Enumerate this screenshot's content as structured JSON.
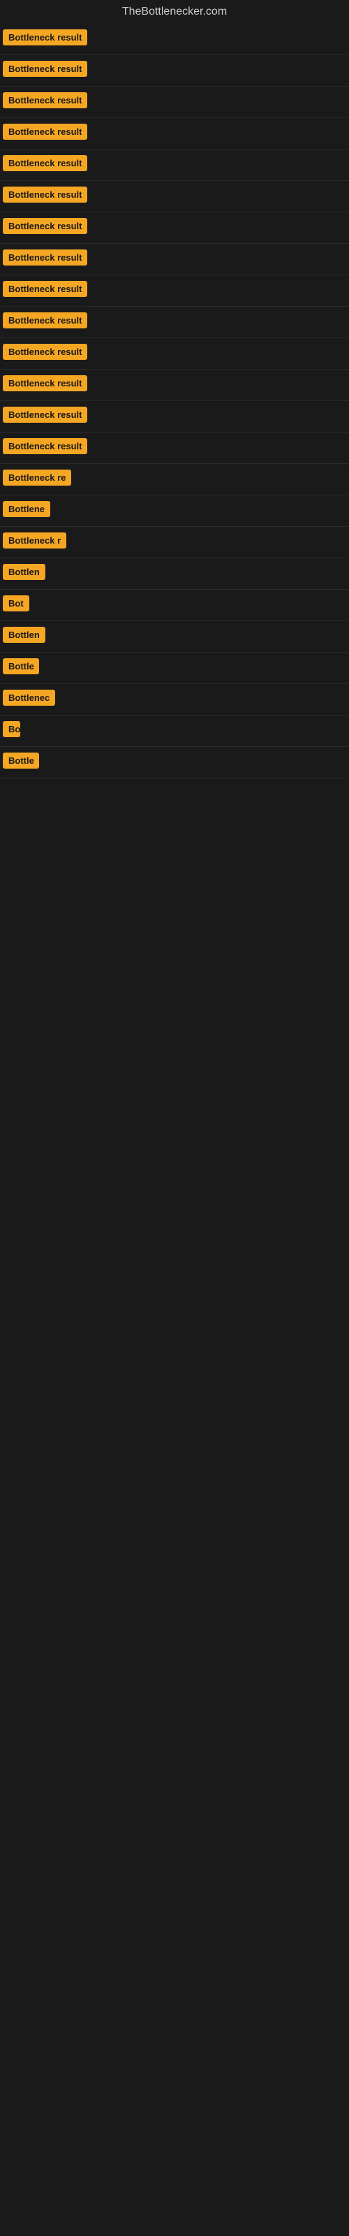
{
  "site": {
    "title": "TheBottlenecker.com"
  },
  "rows": [
    {
      "id": 1,
      "label": "Bottleneck result",
      "visible_width": "full"
    },
    {
      "id": 2,
      "label": "Bottleneck result",
      "visible_width": "full"
    },
    {
      "id": 3,
      "label": "Bottleneck result",
      "visible_width": "full"
    },
    {
      "id": 4,
      "label": "Bottleneck result",
      "visible_width": "full"
    },
    {
      "id": 5,
      "label": "Bottleneck result",
      "visible_width": "full"
    },
    {
      "id": 6,
      "label": "Bottleneck result",
      "visible_width": "full"
    },
    {
      "id": 7,
      "label": "Bottleneck result",
      "visible_width": "full"
    },
    {
      "id": 8,
      "label": "Bottleneck result",
      "visible_width": "full"
    },
    {
      "id": 9,
      "label": "Bottleneck result",
      "visible_width": "full"
    },
    {
      "id": 10,
      "label": "Bottleneck result",
      "visible_width": "full"
    },
    {
      "id": 11,
      "label": "Bottleneck result",
      "visible_width": "full"
    },
    {
      "id": 12,
      "label": "Bottleneck result",
      "visible_width": "full"
    },
    {
      "id": 13,
      "label": "Bottleneck result",
      "visible_width": "full"
    },
    {
      "id": 14,
      "label": "Bottleneck result",
      "visible_width": "full"
    },
    {
      "id": 15,
      "label": "Bottleneck re",
      "visible_width": "partial-15"
    },
    {
      "id": 16,
      "label": "Bottlene",
      "visible_width": "partial-16"
    },
    {
      "id": 17,
      "label": "Bottleneck r",
      "visible_width": "partial-17"
    },
    {
      "id": 18,
      "label": "Bottlen",
      "visible_width": "partial-18"
    },
    {
      "id": 19,
      "label": "Bot",
      "visible_width": "partial-19"
    },
    {
      "id": 20,
      "label": "Bottlen",
      "visible_width": "partial-20"
    },
    {
      "id": 21,
      "label": "Bottle",
      "visible_width": "partial-21"
    },
    {
      "id": 22,
      "label": "Bottlenec",
      "visible_width": "partial-22"
    },
    {
      "id": 23,
      "label": "Bo",
      "visible_width": "partial-23"
    },
    {
      "id": 24,
      "label": "Bottle",
      "visible_width": "partial-24"
    }
  ],
  "badge_color": "#f5a623",
  "bg_color": "#1a1a1a"
}
